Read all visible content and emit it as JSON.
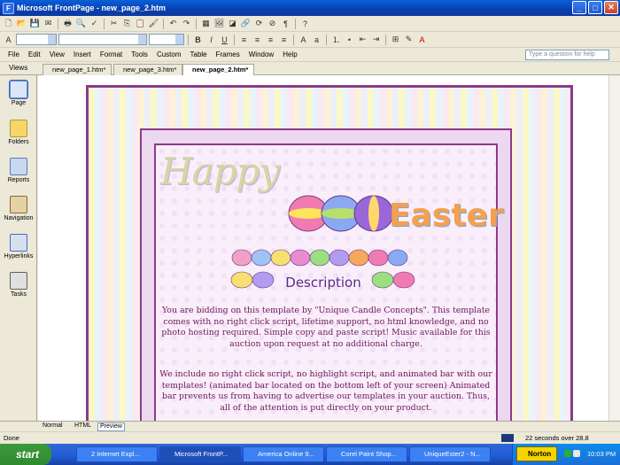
{
  "window": {
    "title": "Microsoft FrontPage - new_page_2.htm"
  },
  "menus": [
    "File",
    "Edit",
    "View",
    "Insert",
    "Format",
    "Tools",
    "Custom",
    "Table",
    "Frames",
    "Window",
    "Help"
  ],
  "help_placeholder": "Type a question for help",
  "views": {
    "header": "Views",
    "items": [
      "Page",
      "Folders",
      "Reports",
      "Navigation",
      "Hyperlinks",
      "Tasks"
    ]
  },
  "tabs": [
    "new_page_1.htm*",
    "new_page_3.htm*",
    "new_page_2.htm*"
  ],
  "page": {
    "happy": "Happy",
    "easter": "Easter",
    "heading": "Description",
    "p1": "You are bidding on this template by \"Unique Candle Concepts\". This template comes with no right click script, lifetime support, no html knowledge, and no photo hosting required. Simple copy and paste script! Music available for this auction upon request at no additional charge.",
    "p2": "We include no right click script, no highlight script, and animated bar with our templates! (animated bar located on the bottom left of your screen) Animated bar prevents us from having to advertise our templates in your auction. Thus, all of the attention is put directly on your product."
  },
  "view_modes": [
    "Normal",
    "HTML",
    "Preview"
  ],
  "status": {
    "left": "Done",
    "right": "22 seconds over 28.8"
  },
  "taskbar": {
    "start": "start",
    "tasks": [
      "2 Internet Expl...",
      "Microsoft FrontP...",
      "America Online 9...",
      "Corel Paint Shop...",
      "UniqueEster2 - N..."
    ],
    "norton": "Norton",
    "clock": "10:03 PM"
  }
}
